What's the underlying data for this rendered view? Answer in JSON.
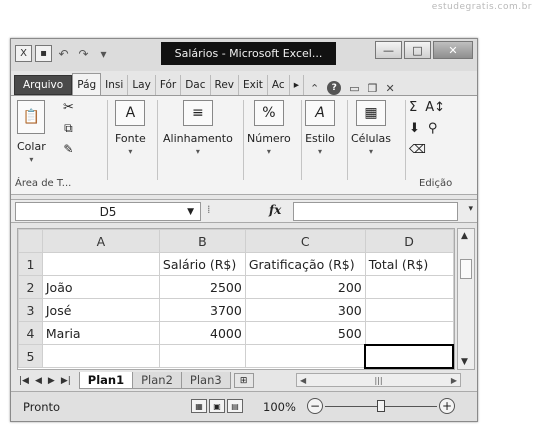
{
  "watermark": "estudegratis.com.br",
  "window": {
    "title": "Salários - Microsoft Excel...",
    "qat": {
      "excel_icon": "X",
      "undo_glyph": "↶",
      "redo_glyph": "↷"
    },
    "controls": {
      "minimize": "—",
      "maximize": "□",
      "close": "✕"
    }
  },
  "ribbon_tabs": {
    "file": "Arquivo",
    "tabs": [
      "Pág",
      "Insi",
      "Lay",
      "Fór",
      "Dac",
      "Rev",
      "Exit",
      "Ac"
    ],
    "active_index": 0,
    "more": "▸"
  },
  "ribbon": {
    "clipboard": {
      "label": "Colar",
      "group": "Área de T..."
    },
    "font": {
      "label": "Fonte",
      "icon": "A"
    },
    "alignment": {
      "label": "Alinhamento",
      "icon": "≡"
    },
    "number": {
      "label": "Número",
      "icon": "%"
    },
    "styles": {
      "label": "Estilo",
      "icon": "A"
    },
    "cells": {
      "label": "Células",
      "icon": "▦"
    },
    "editing": {
      "group": "Edição",
      "sum": "Σ",
      "sort": "A↕",
      "find": "⚲"
    }
  },
  "formula_bar": {
    "name_box": "D5",
    "fx": "fx",
    "formula": ""
  },
  "sheet": {
    "columns": [
      "A",
      "B",
      "C",
      "D"
    ],
    "rows": [
      {
        "n": "1",
        "a": "",
        "b": "Salário (R$)",
        "c": "Gratificação (R$)",
        "d": "Total (R$)"
      },
      {
        "n": "2",
        "a": "João",
        "b": "2500",
        "c": "200",
        "d": ""
      },
      {
        "n": "3",
        "a": "José",
        "b": "3700",
        "c": "300",
        "d": ""
      },
      {
        "n": "4",
        "a": "Maria",
        "b": "4000",
        "c": "500",
        "d": ""
      },
      {
        "n": "5",
        "a": "",
        "b": "",
        "c": "",
        "d": ""
      }
    ],
    "selected_cell": "D5"
  },
  "sheet_tabs": [
    "Plan1",
    "Plan2",
    "Plan3"
  ],
  "active_sheet": "Plan1",
  "status": {
    "ready": "Pronto",
    "zoom": "100%"
  }
}
